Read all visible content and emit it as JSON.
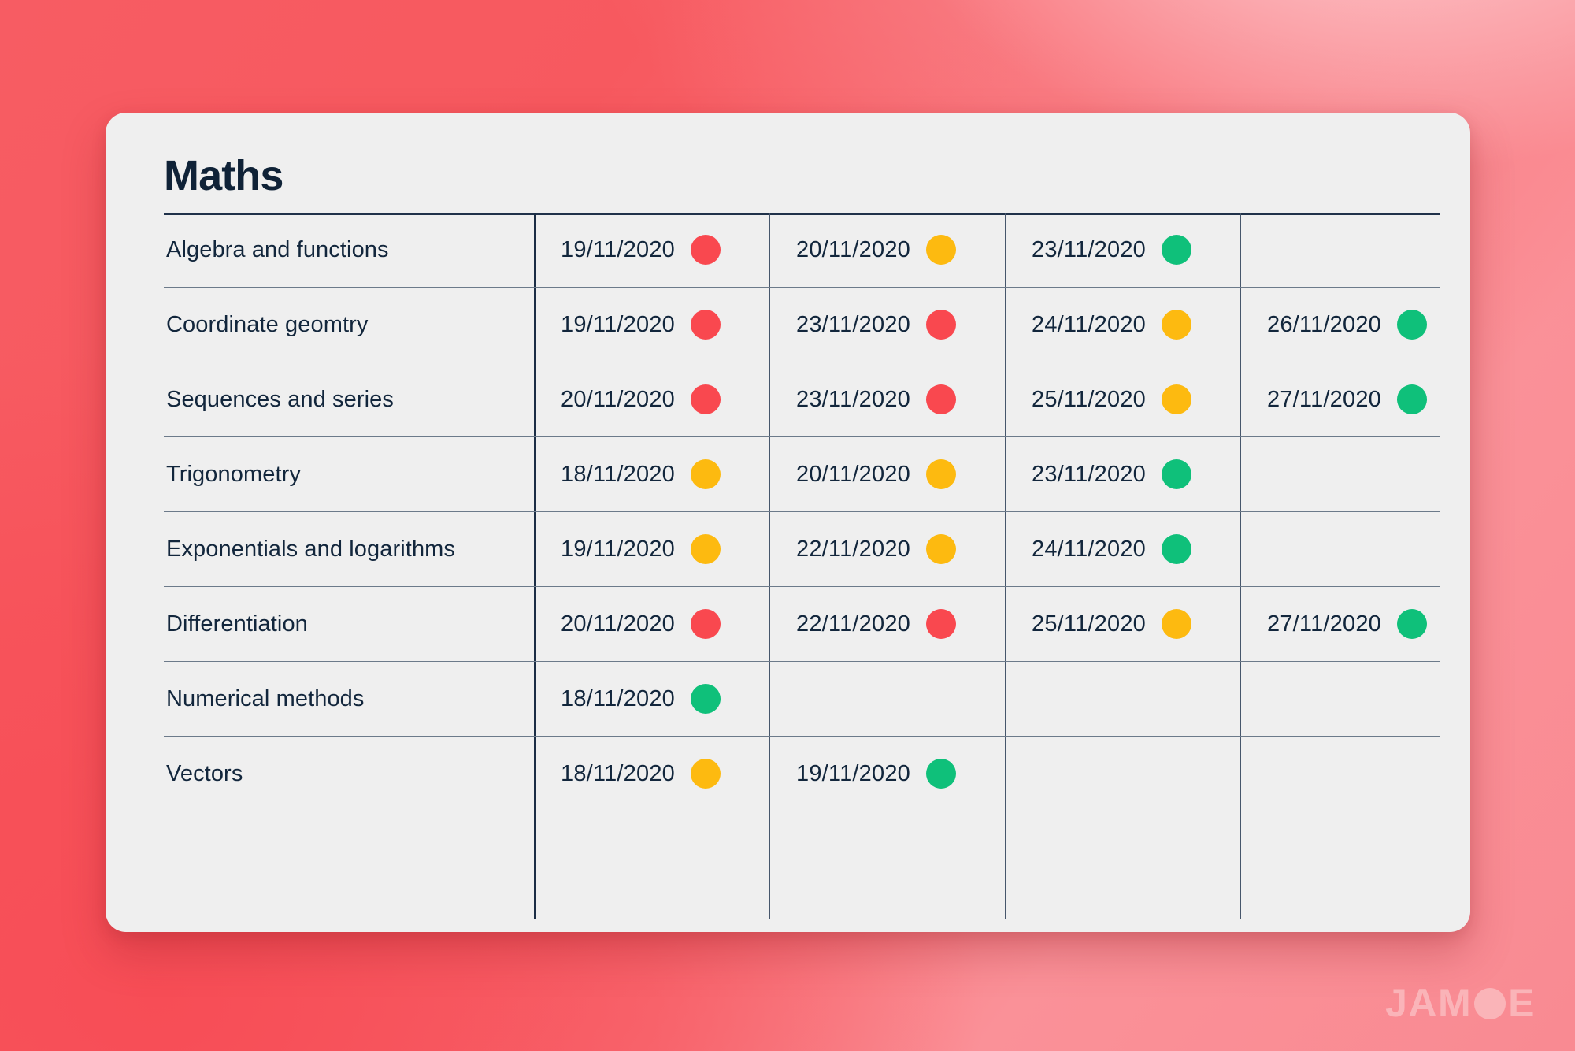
{
  "page": {
    "background_color_start": "#F75C63",
    "background_color_end": "#FAA3A9"
  },
  "card": {
    "background_color": "#EFEFEF",
    "title": "Maths"
  },
  "status_colors": {
    "red": "#F9484F",
    "amber": "#FDBA10",
    "green": "#0FC07A"
  },
  "table": {
    "column_count": 5,
    "rows": [
      {
        "topic": "Algebra and functions",
        "entries": [
          {
            "date": "19/11/2020",
            "status": "red"
          },
          {
            "date": "20/11/2020",
            "status": "amber"
          },
          {
            "date": "23/11/2020",
            "status": "green"
          },
          {
            "date": "",
            "status": ""
          }
        ]
      },
      {
        "topic": "Coordinate geomtry",
        "entries": [
          {
            "date": "19/11/2020",
            "status": "red"
          },
          {
            "date": "23/11/2020",
            "status": "red"
          },
          {
            "date": "24/11/2020",
            "status": "amber"
          },
          {
            "date": "26/11/2020",
            "status": "green"
          }
        ]
      },
      {
        "topic": "Sequences and series",
        "entries": [
          {
            "date": "20/11/2020",
            "status": "red"
          },
          {
            "date": "23/11/2020",
            "status": "red"
          },
          {
            "date": "25/11/2020",
            "status": "amber"
          },
          {
            "date": "27/11/2020",
            "status": "green"
          }
        ]
      },
      {
        "topic": "Trigonometry",
        "entries": [
          {
            "date": "18/11/2020",
            "status": "amber"
          },
          {
            "date": "20/11/2020",
            "status": "amber"
          },
          {
            "date": "23/11/2020",
            "status": "green"
          },
          {
            "date": "",
            "status": ""
          }
        ]
      },
      {
        "topic": "Exponentials and logarithms",
        "entries": [
          {
            "date": "19/11/2020",
            "status": "amber"
          },
          {
            "date": "22/11/2020",
            "status": "amber"
          },
          {
            "date": "24/11/2020",
            "status": "green"
          },
          {
            "date": "",
            "status": ""
          }
        ]
      },
      {
        "topic": "Differentiation",
        "entries": [
          {
            "date": "20/11/2020",
            "status": "red"
          },
          {
            "date": "22/11/2020",
            "status": "red"
          },
          {
            "date": "25/11/2020",
            "status": "amber"
          },
          {
            "date": "27/11/2020",
            "status": "green"
          }
        ]
      },
      {
        "topic": "Numerical methods",
        "entries": [
          {
            "date": "18/11/2020",
            "status": "green"
          },
          {
            "date": "",
            "status": ""
          },
          {
            "date": "",
            "status": ""
          },
          {
            "date": "",
            "status": ""
          }
        ]
      },
      {
        "topic": "Vectors",
        "entries": [
          {
            "date": "18/11/2020",
            "status": "amber"
          },
          {
            "date": "19/11/2020",
            "status": "green"
          },
          {
            "date": "",
            "status": ""
          },
          {
            "date": "",
            "status": ""
          }
        ]
      }
    ]
  },
  "logo": {
    "text_before": "JAM",
    "circle_icon": "filled-circle-o",
    "text_after": "E",
    "color": "#FBB7BB"
  }
}
